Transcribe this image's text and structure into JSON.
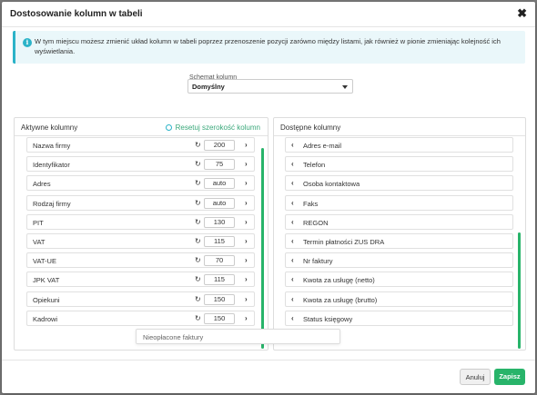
{
  "modal": {
    "title": "Dostosowanie kolumn w tabeli",
    "close_symbol": "✖"
  },
  "info": {
    "icon": "info-icon",
    "text": "W tym miejscu możesz zmienić układ kolumn w tabeli poprzez przenoszenie pozycji zarówno między listami, jak również w pionie zmieniając kolejność ich wyświetlania."
  },
  "schema": {
    "label": "Schemat kolumn",
    "value": "Domyślny"
  },
  "active": {
    "title": "Aktywne kolumny",
    "reset_label": "Resetuj szerokość kolumn",
    "items": [
      {
        "label": "Nazwa firmy",
        "width": "200"
      },
      {
        "label": "Identyfikator",
        "width": "75"
      },
      {
        "label": "Adres",
        "width": "auto"
      },
      {
        "label": "Rodzaj firmy",
        "width": "auto"
      },
      {
        "label": "PIT",
        "width": "130"
      },
      {
        "label": "VAT",
        "width": "115"
      },
      {
        "label": "VAT-UE",
        "width": "70"
      },
      {
        "label": "JPK VAT",
        "width": "115"
      },
      {
        "label": "Opiekuni",
        "width": "150"
      },
      {
        "label": "Kadrowi",
        "width": "150"
      }
    ]
  },
  "available": {
    "title": "Dostępne kolumny",
    "items": [
      "Adres e-mail",
      "Telefon",
      "Osoba kontaktowa",
      "Faks",
      "REGON",
      "Termin płatności ZUS DRA",
      "Nr faktury",
      "Kwota za usługę (netto)",
      "Kwota za usługę (brutto)",
      "Status księgowy"
    ]
  },
  "dragging": {
    "label": "Nieopłacone faktury"
  },
  "footer": {
    "cancel_label": "Anuluj",
    "save_label": "Zapisz"
  },
  "colors": {
    "accent": "#28b46a",
    "info": "#2bb3c8"
  },
  "icons": {
    "refresh": "↻",
    "chevron_right": "›",
    "chevron_left": "‹"
  }
}
